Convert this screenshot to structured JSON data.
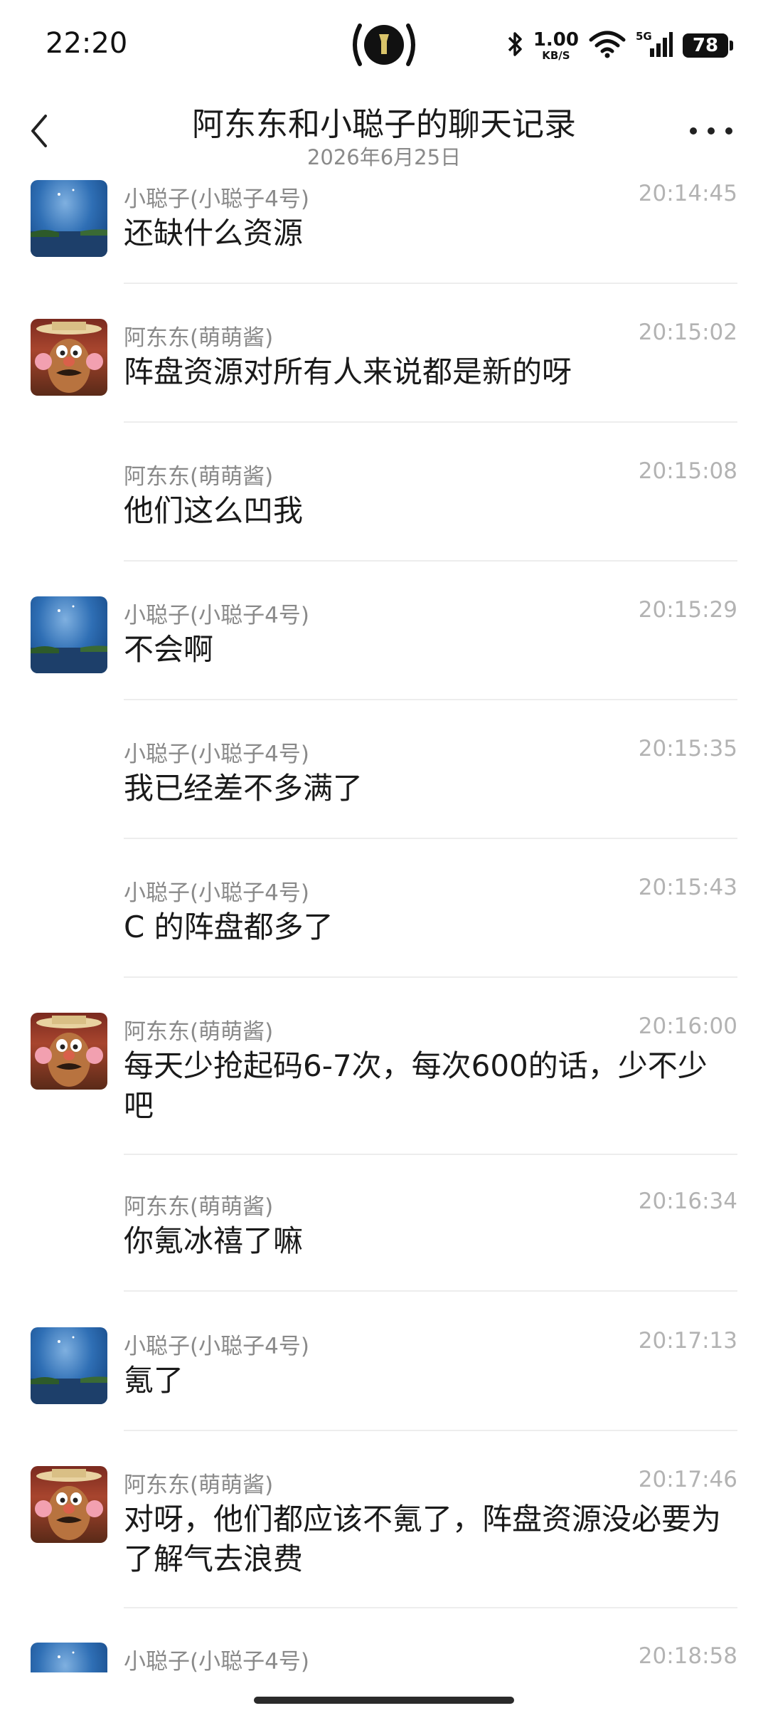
{
  "status_bar": {
    "time": "22:20",
    "network_speed": "1.00",
    "network_unit": "KB/S",
    "battery": "78",
    "icons": [
      "flashlight-icon",
      "bluetooth-icon",
      "wifi-icon",
      "5g-signal-icon",
      "battery-icon"
    ]
  },
  "header": {
    "title": "阿东东和小聪子的聊天记录",
    "date": "2026年6月25日",
    "back_icon": "chevron-left-icon",
    "more_icon": "more-dots-icon"
  },
  "messages": [
    {
      "sender": "小聪子(小聪子4号)",
      "time": "20:14:45",
      "text": "还缺什么资源",
      "avatar": "sky"
    },
    {
      "sender": "阿东东(萌萌酱)",
      "time": "20:15:02",
      "text": "阵盘资源对所有人来说都是新的呀",
      "avatar": "potato"
    },
    {
      "sender": "阿东东(萌萌酱)",
      "time": "20:15:08",
      "text": "他们这么凹我",
      "avatar": ""
    },
    {
      "sender": "小聪子(小聪子4号)",
      "time": "20:15:29",
      "text": "不会啊",
      "avatar": "sky"
    },
    {
      "sender": "小聪子(小聪子4号)",
      "time": "20:15:35",
      "text": "我已经差不多满了",
      "avatar": ""
    },
    {
      "sender": "小聪子(小聪子4号)",
      "time": "20:15:43",
      "text": "C 的阵盘都多了",
      "avatar": ""
    },
    {
      "sender": "阿东东(萌萌酱)",
      "time": "20:16:00",
      "text": "每天少抢起码6-7次，每次600的话，少不少吧",
      "avatar": "potato"
    },
    {
      "sender": "阿东东(萌萌酱)",
      "time": "20:16:34",
      "text": "你氪冰禧了嘛",
      "avatar": ""
    },
    {
      "sender": "小聪子(小聪子4号)",
      "time": "20:17:13",
      "text": "氪了",
      "avatar": "sky"
    },
    {
      "sender": "阿东东(萌萌酱)",
      "time": "20:17:46",
      "text": "对呀，他们都应该不氪了，阵盘资源没必要为了解气去浪费",
      "avatar": "potato"
    },
    {
      "sender": "小聪子(小聪子4号)",
      "time": "20:18:58",
      "text": "",
      "avatar": "sky"
    }
  ]
}
